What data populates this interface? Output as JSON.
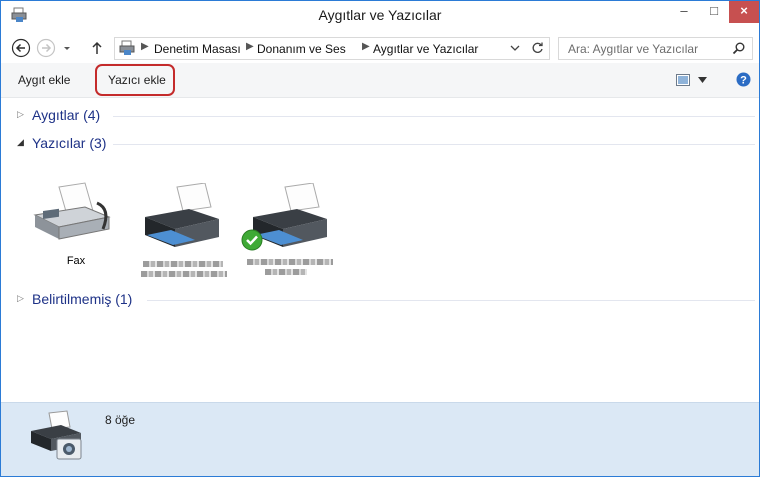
{
  "window": {
    "title": "Aygıtlar ve Yazıcılar"
  },
  "controls": {
    "minimize": "–",
    "maximize": "□",
    "close": "×"
  },
  "address": {
    "crumbs": [
      "Denetim Masası",
      "Donanım ve Ses",
      "Aygıtlar ve Yazıcılar"
    ],
    "search_placeholder": "Ara: Aygıtlar ve Yazıcılar"
  },
  "toolbar": {
    "add_device": "Aygıt ekle",
    "add_printer": "Yazıcı ekle",
    "highlight_color": "#c42b2b"
  },
  "groups": [
    {
      "title": "Aygıtlar (4)",
      "expanded": false
    },
    {
      "title": "Yazıcılar (3)",
      "expanded": true
    },
    {
      "title": "Belirtilmemiş (1)",
      "expanded": false
    }
  ],
  "printers": [
    {
      "label": "Fax",
      "icon": "fax-icon"
    },
    {
      "label": "",
      "icon": "printer-icon"
    },
    {
      "label": "",
      "icon": "printer-default-icon",
      "default": true
    }
  ],
  "details": {
    "count_text": "8 öğe"
  },
  "colors": {
    "group_title": "#1e3287",
    "details_bg": "#dbe8f5",
    "accent": "#2b7bd6"
  }
}
